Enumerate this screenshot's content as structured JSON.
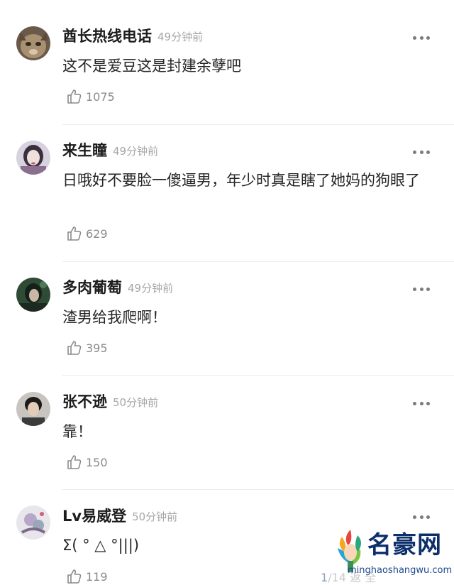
{
  "comments": [
    {
      "username": "酋长热线电话",
      "time": "49分钟前",
      "text": "这不是爱豆这是封建余孽吧",
      "likes": "1075"
    },
    {
      "username": "来生瞳",
      "time": "49分钟前",
      "text": "日哦好不要脸一傻逼男，年少时真是瞎了她妈的狗眼了",
      "likes": "629"
    },
    {
      "username": "多肉葡萄",
      "time": "49分钟前",
      "text": "渣男给我爬啊！",
      "likes": "395"
    },
    {
      "username": "张不逊",
      "time": "50分钟前",
      "text": "靠！",
      "likes": "150"
    },
    {
      "username": "Lv易威登",
      "time": "50分钟前",
      "text": "Σ( ° △ °|||)",
      "likes": "119"
    }
  ],
  "watermark": {
    "name": "名豪网",
    "url": "minghaoshangwu.com"
  },
  "pager": {
    "current": "1",
    "rest": "/14  返 全"
  },
  "colors": {
    "text": "#262626",
    "meta": "#a6a6a6",
    "like": "#8a8a8a",
    "divider": "#ededed"
  }
}
